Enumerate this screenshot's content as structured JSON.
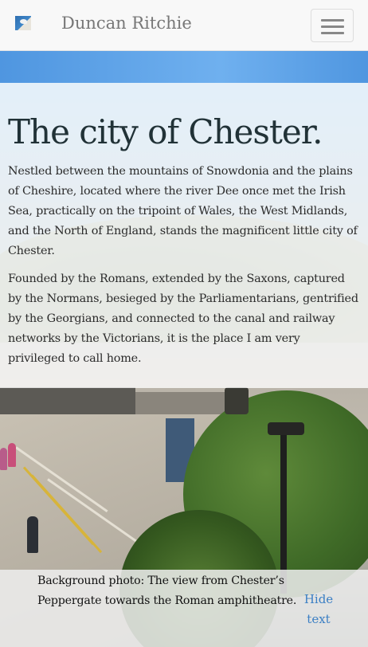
{
  "navbar": {
    "brand_name": "Duncan Ritchie",
    "logo_icon": "bird-logo-icon",
    "menu_icon": "hamburger-menu-icon"
  },
  "intro": {
    "title": "The city of Chester.",
    "paragraphs": [
      "Nestled between the mountains of Snowdonia and the plains of Cheshire, located where the river Dee once met the Irish Sea, practically on the tripoint of Wales, the West Midlands, and the North of England, stands the magnificent little city of Chester.",
      "Founded by the Romans, extended by the Saxons, captured by the Normans, besieged by the Parliamentarians, gentrified by the Georgians, and connected to the canal and railway networks by the Victorians, it is the place I am very privileged to call home."
    ]
  },
  "caption": {
    "text": "Background photo: The view from Chester’s Peppergate towards the Roman amphitheatre.",
    "hide_label": "Hide text"
  },
  "colors": {
    "link": "#3b7fc4",
    "heading": "#213237",
    "navbar_bg": "#f8f8f8"
  }
}
